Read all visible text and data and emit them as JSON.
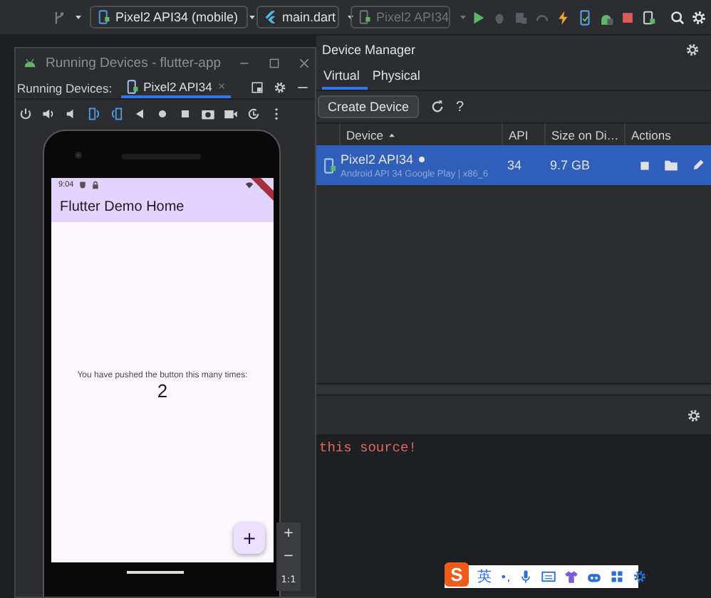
{
  "toolbar": {
    "device_selector": "Pixel2 API34 (mobile)",
    "run_config": "main.dart",
    "target_device": {
      "label": "Pixel2 API34",
      "disabled": true
    }
  },
  "running_devices": {
    "title": "Running Devices - flutter-app",
    "label": "Running Devices:",
    "tabs": [
      {
        "label": "Pixel2 API34",
        "selected": true
      }
    ],
    "phone": {
      "time": "9:04",
      "app_title": "Flutter Demo Home",
      "message": "You have pushed the button this many times:",
      "counter": "2",
      "fab": "+"
    },
    "zoom_controls": [
      "+",
      "−",
      "1:1"
    ]
  },
  "device_manager": {
    "title": "Device Manager",
    "tabs": [
      {
        "label": "Virtual",
        "selected": true
      },
      {
        "label": "Physical",
        "selected": false
      }
    ],
    "create_button": "Create Device",
    "help": "?",
    "columns": [
      "Device",
      "API",
      "Size on Di…",
      "Actions"
    ],
    "rows": [
      {
        "name": "Pixel2 API34",
        "details": "Android API 34 Google Play | x86_6",
        "api": "34",
        "size": "9.7 GB",
        "selected": true,
        "running": true
      }
    ]
  },
  "console": {
    "text": "this source!"
  },
  "ime_toolbar": {
    "logo": "S",
    "mode": "英",
    "punctuation": "•,"
  }
}
